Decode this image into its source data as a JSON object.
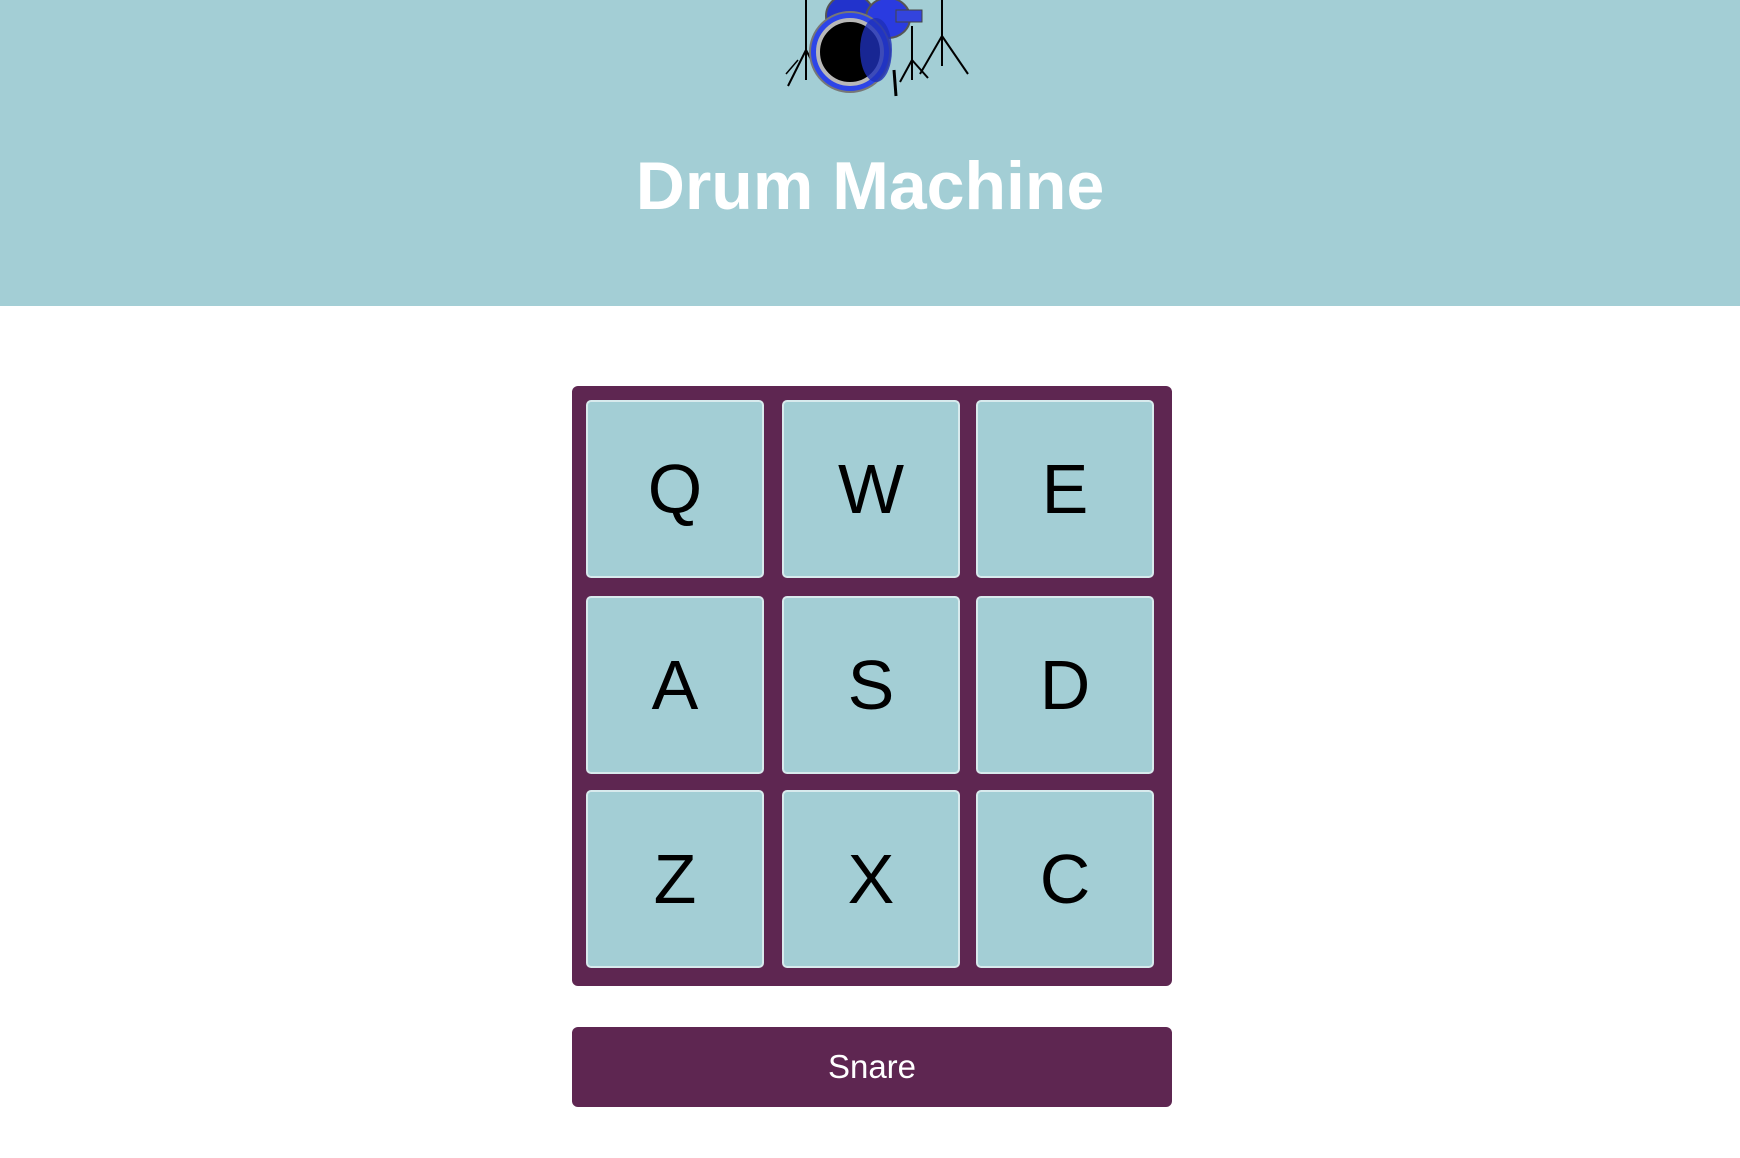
{
  "header": {
    "title": "Drum Machine",
    "logo_icon": "drum-kit-icon",
    "background_color": "#a3ced5"
  },
  "pad_board": {
    "background_color": "#5e2651",
    "pads": [
      {
        "key": "Q"
      },
      {
        "key": "W"
      },
      {
        "key": "E"
      },
      {
        "key": "A"
      },
      {
        "key": "S"
      },
      {
        "key": "D"
      },
      {
        "key": "Z"
      },
      {
        "key": "X"
      },
      {
        "key": "C"
      }
    ]
  },
  "display": {
    "text": "Snare"
  }
}
